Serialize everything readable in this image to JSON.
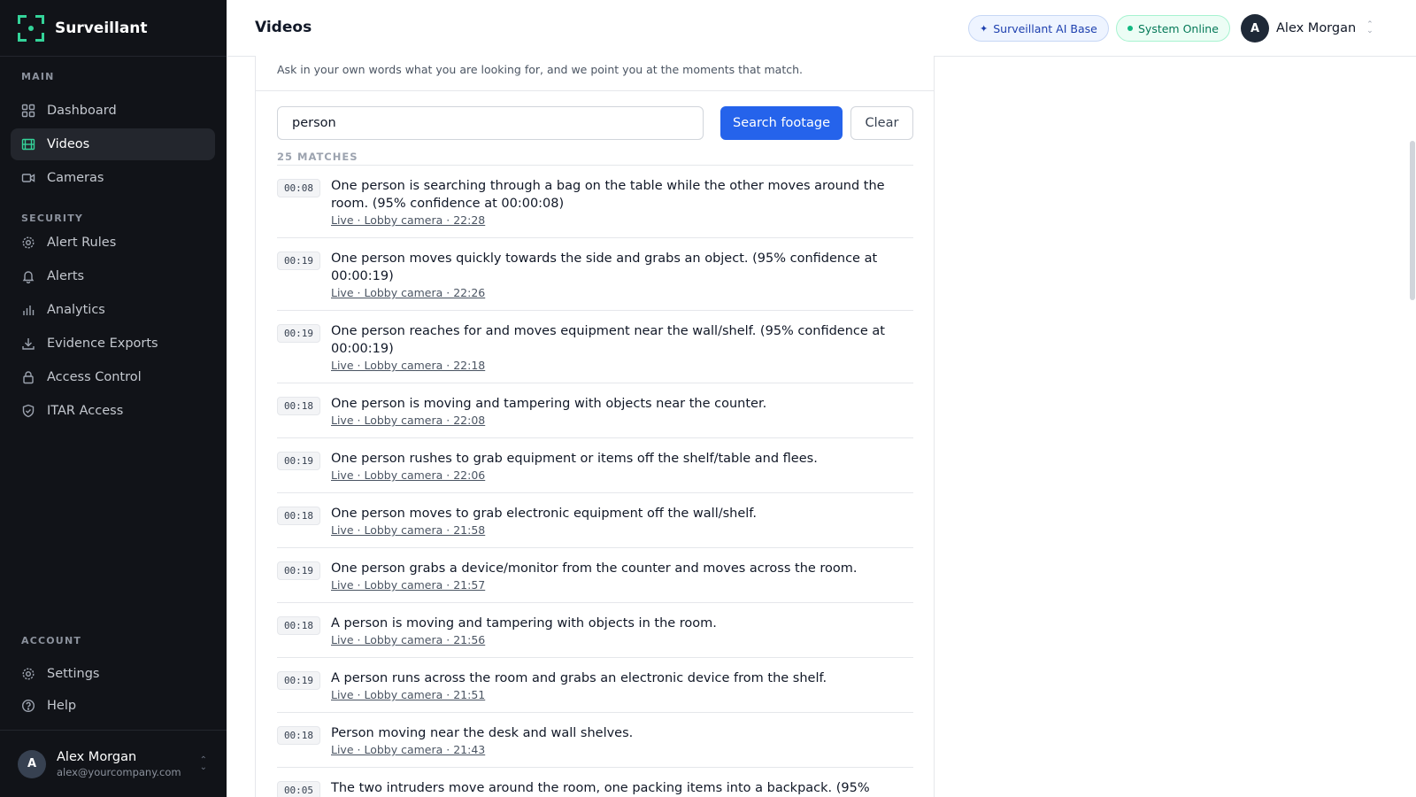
{
  "app": {
    "name": "Surveillant"
  },
  "sidebar": {
    "sections": [
      {
        "title": "MAIN"
      },
      {
        "title": "SECURITY"
      },
      {
        "title": "ACCOUNT"
      }
    ],
    "items": [
      {
        "label": "Dashboard",
        "icon": "grid-icon"
      },
      {
        "label": "Videos",
        "icon": "film-icon",
        "active": true
      },
      {
        "label": "Cameras",
        "icon": "video-camera-icon"
      },
      {
        "label": "Alert Rules",
        "icon": "gear-icon"
      },
      {
        "label": "Alerts",
        "icon": "bell-icon"
      },
      {
        "label": "Analytics",
        "icon": "bar-chart-icon"
      },
      {
        "label": "Evidence Exports",
        "icon": "download-icon"
      },
      {
        "label": "Access Control",
        "icon": "lock-icon"
      },
      {
        "label": "ITAR Access",
        "icon": "shield-icon"
      },
      {
        "label": "Settings",
        "icon": "gear-icon"
      },
      {
        "label": "Help",
        "icon": "help-circle-icon"
      }
    ],
    "user": {
      "initial": "A",
      "name": "Alex Morgan",
      "email": "alex@yourcompany.com"
    }
  },
  "header": {
    "title": "Videos",
    "ai_badge": "Surveillant AI Base",
    "status_badge": "System Online",
    "user": {
      "initial": "A",
      "name": "Alex Morgan"
    }
  },
  "search": {
    "subtitle": "Ask in your own words what you are looking for, and we point you at the moments that match.",
    "query": "person",
    "submit_label": "Search footage",
    "clear_label": "Clear",
    "matches_label": "25 MATCHES"
  },
  "results": [
    {
      "time": "00:08",
      "text": "One person is searching through a bag on the table while the other moves around the room. (95% confidence at 00:00:08)",
      "meta": "Live · Lobby camera · 22:28"
    },
    {
      "time": "00:19",
      "text": "One person moves quickly towards the side and grabs an object. (95% confidence at 00:00:19)",
      "meta": "Live · Lobby camera · 22:26"
    },
    {
      "time": "00:19",
      "text": "One person reaches for and moves equipment near the wall/shelf. (95% confidence at 00:00:19)",
      "meta": "Live · Lobby camera · 22:18"
    },
    {
      "time": "00:18",
      "text": "One person is moving and tampering with objects near the counter.",
      "meta": "Live · Lobby camera · 22:08"
    },
    {
      "time": "00:19",
      "text": "One person rushes to grab equipment or items off the shelf/table and flees.",
      "meta": "Live · Lobby camera · 22:06"
    },
    {
      "time": "00:18",
      "text": "One person moves to grab electronic equipment off the wall/shelf.",
      "meta": "Live · Lobby camera · 21:58"
    },
    {
      "time": "00:19",
      "text": "One person grabs a device/monitor from the counter and moves across the room.",
      "meta": "Live · Lobby camera · 21:57"
    },
    {
      "time": "00:18",
      "text": "A person is moving and tampering with objects in the room.",
      "meta": "Live · Lobby camera · 21:56"
    },
    {
      "time": "00:19",
      "text": "A person runs across the room and grabs an electronic device from the shelf.",
      "meta": "Live · Lobby camera · 21:51"
    },
    {
      "time": "00:18",
      "text": "Person moving near the desk and wall shelves.",
      "meta": "Live · Lobby camera · 21:43"
    },
    {
      "time": "00:05",
      "text": "The two intruders move around the room, one packing items into a backpack. (95%",
      "meta": ""
    }
  ],
  "colors": {
    "sidebar_bg": "#111318",
    "accent": "#2563eb",
    "brand": "#34d399",
    "online": "#10b981"
  }
}
